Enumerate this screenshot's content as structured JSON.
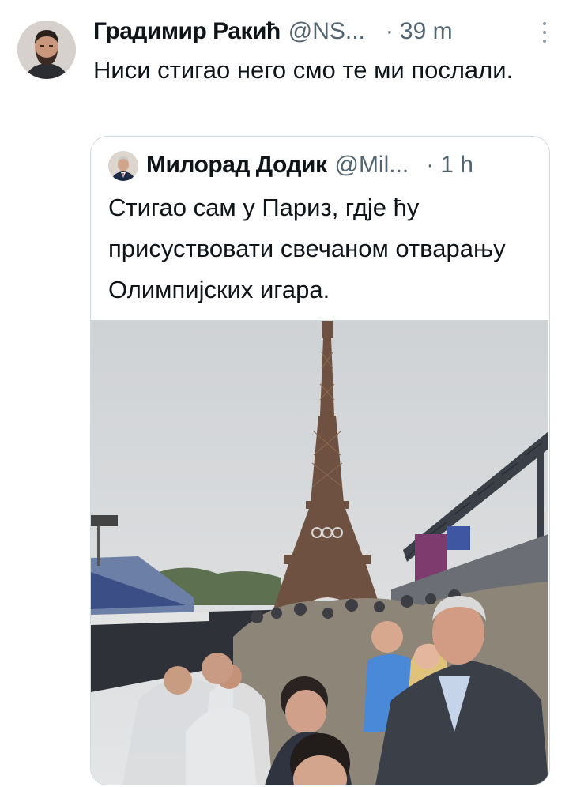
{
  "tweet": {
    "author_name": "Градимир Ракић",
    "author_handle": "@NS...",
    "separator": "·",
    "time": "39 m",
    "text": "Ниси стигао него смо те ми послали.",
    "avatar_icon": "profile-photo-bearded-man",
    "more_icon": "vertical-ellipsis-icon"
  },
  "quoted": {
    "author_name": "Милорад Додик",
    "author_handle": "@Mil...",
    "separator": "·",
    "time": "1 h",
    "text": "Стигао сам у Париз, гдје ћу присуствовати свечаном отварању Олимпијских игара.",
    "avatar_icon": "profile-photo-man-suit",
    "media_description_icon": "photo-eiffel-tower-stadium-crowd"
  },
  "colors": {
    "text": "#0f1419",
    "secondary": "#536471",
    "border": "#cfd9de",
    "sky": "#d7d9db"
  }
}
